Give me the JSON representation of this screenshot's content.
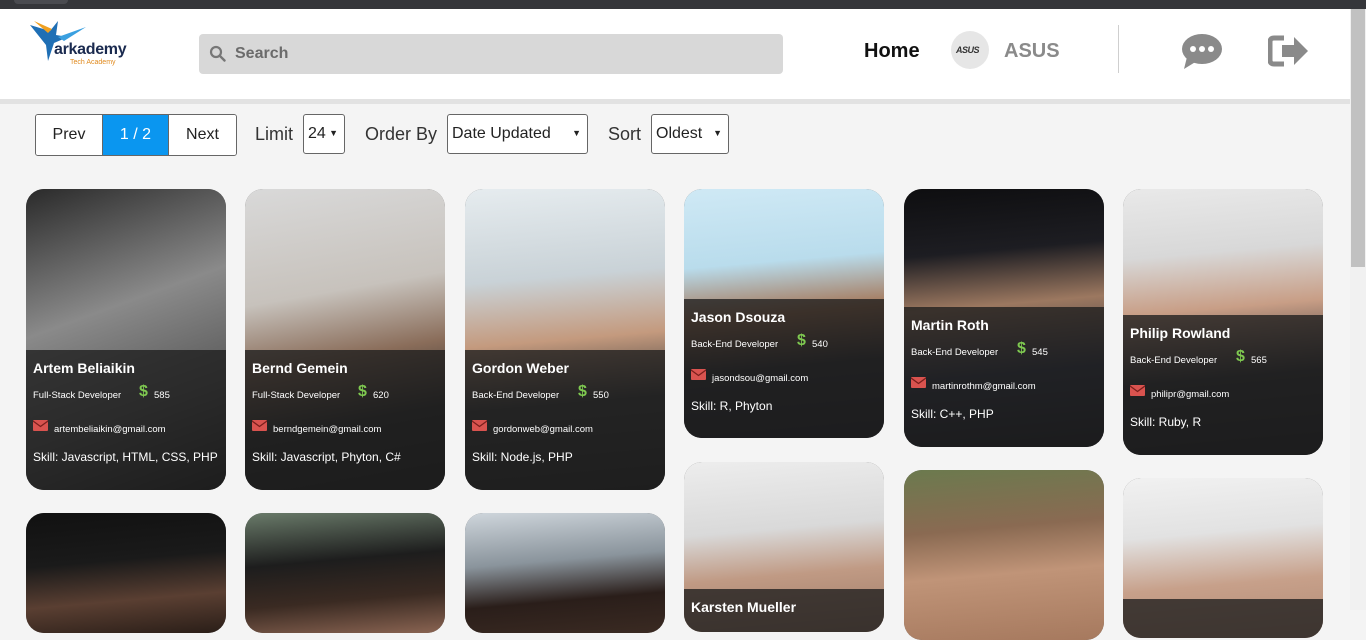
{
  "logo": {
    "word": "arkademy",
    "sub": "Tech Academy"
  },
  "search": {
    "placeholder": "Search",
    "value": ""
  },
  "nav": {
    "home": "Home",
    "company": "ASUS",
    "avatar_mark": "ASUS"
  },
  "icons": {
    "search": "search-icon",
    "chat": "chat-bubble-icon",
    "logout": "logout-icon",
    "mail": "mail-icon",
    "dollar": "dollar-icon"
  },
  "colors": {
    "accent": "#0a96f0",
    "rate": "#7ec850",
    "mail": "#d9534f"
  },
  "controls": {
    "pagination": {
      "prev": "Prev",
      "current": "1 / 2",
      "next": "Next"
    },
    "limit_label": "Limit",
    "limit_value": "24",
    "order_label": "Order By",
    "order_value": "Date Updated",
    "sort_label": "Sort",
    "sort_value": "Oldest"
  },
  "cards": [
    {
      "name": "Artem Beliaikin",
      "role": "Full-Stack Developer",
      "rate": "585",
      "email": "artembeliaikin@gmail.com",
      "skill": "Skill: Javascript, HTML, CSS, PHP"
    },
    {
      "name": "Bernd Gemein",
      "role": "Full-Stack Developer",
      "rate": "620",
      "email": "berndgemein@gmail.com",
      "skill": "Skill: Javascript, Phyton, C#"
    },
    {
      "name": "Gordon Weber",
      "role": "Back-End Developer",
      "rate": "550",
      "email": "gordonweb@gmail.com",
      "skill": "Skill: Node.js, PHP"
    },
    {
      "name": "Jason Dsouza",
      "role": "Back-End Developer",
      "rate": "540",
      "email": "jasondsou@gmail.com",
      "skill": "Skill: R, Phyton"
    },
    {
      "name": "Martin Roth",
      "role": "Back-End Developer",
      "rate": "545",
      "email": "martinrothm@gmail.com",
      "skill": "Skill: C++, PHP"
    },
    {
      "name": "Philip Rowland",
      "role": "Back-End Developer",
      "rate": "565",
      "email": "philipr@gmail.com",
      "skill": "Skill: Ruby, R"
    },
    {
      "name": "",
      "role": "",
      "rate": "",
      "email": "",
      "skill": ""
    },
    {
      "name": "",
      "role": "",
      "rate": "",
      "email": "",
      "skill": ""
    },
    {
      "name": "",
      "role": "",
      "rate": "",
      "email": "",
      "skill": ""
    },
    {
      "name": "Karsten Mueller",
      "role": "",
      "rate": "",
      "email": "",
      "skill": ""
    },
    {
      "name": "",
      "role": "",
      "rate": "",
      "email": "",
      "skill": ""
    },
    {
      "name": "",
      "role": "",
      "rate": "",
      "email": "",
      "skill": ""
    }
  ]
}
